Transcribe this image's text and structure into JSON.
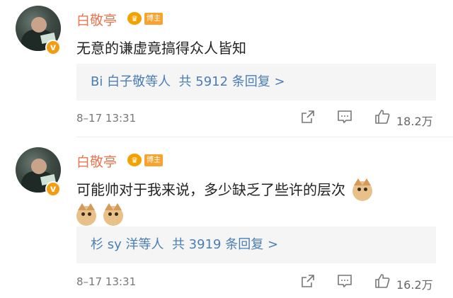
{
  "comments": [
    {
      "username": "白敬亭",
      "owner_badge": "博主",
      "verified_mark": "v",
      "text": "无意的谦虚竟搞得众人皆知",
      "emojis": [],
      "replies": {
        "names": "Bi 白子敬等人",
        "summary": "共 5912 条回复",
        "arrow": ">"
      },
      "date": "8–17 13:31",
      "likes": "18.2万"
    },
    {
      "username": "白敬亭",
      "owner_badge": "博主",
      "verified_mark": "v",
      "text": "可能帅对于我来说，多少缺乏了些许的层次",
      "emojis": [
        "cat-emoji",
        "cat-emoji",
        "cat-emoji"
      ],
      "replies": {
        "names": "杉 sy 洋等人",
        "summary": "共 3919 条回复",
        "arrow": ">"
      },
      "date": "8–17 13:31",
      "likes": "16.2万"
    }
  ],
  "icons": [
    "crown-icon",
    "share-icon",
    "comment-icon",
    "like-icon"
  ],
  "colors": {
    "username": "#eb7350",
    "link": "#4a7db5",
    "badge": "#f6a331",
    "reply_bg": "#f5f5f5"
  }
}
